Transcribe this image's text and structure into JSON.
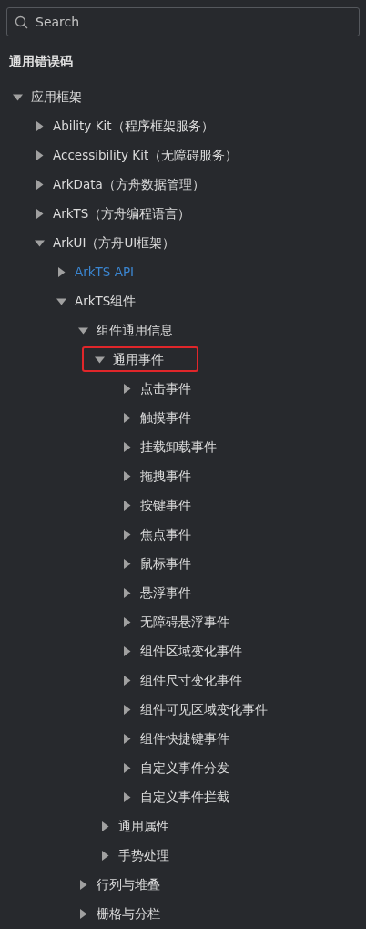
{
  "search": {
    "placeholder": "Search"
  },
  "top_link": "通用错误码",
  "tree": [
    {
      "label": "应用框架",
      "expanded": true,
      "children": [
        {
          "label": "Ability Kit（程序框架服务）",
          "expanded": false
        },
        {
          "label": "Accessibility Kit（无障碍服务）",
          "expanded": false
        },
        {
          "label": "ArkData（方舟数据管理）",
          "expanded": false
        },
        {
          "label": "ArkTS（方舟编程语言）",
          "expanded": false
        },
        {
          "label": "ArkUI（方舟UI框架）",
          "expanded": true,
          "children": [
            {
              "label": "ArkTS API",
              "expanded": false,
              "selected": true
            },
            {
              "label": "ArkTS组件",
              "expanded": true,
              "children": [
                {
                  "label": "组件通用信息",
                  "expanded": true,
                  "children": [
                    {
                      "label": "通用事件",
                      "expanded": true,
                      "highlighted": true,
                      "children": [
                        {
                          "label": "点击事件",
                          "expanded": false
                        },
                        {
                          "label": "触摸事件",
                          "expanded": false
                        },
                        {
                          "label": "挂载卸载事件",
                          "expanded": false
                        },
                        {
                          "label": "拖拽事件",
                          "expanded": false
                        },
                        {
                          "label": "按键事件",
                          "expanded": false
                        },
                        {
                          "label": "焦点事件",
                          "expanded": false
                        },
                        {
                          "label": "鼠标事件",
                          "expanded": false
                        },
                        {
                          "label": "悬浮事件",
                          "expanded": false
                        },
                        {
                          "label": "无障碍悬浮事件",
                          "expanded": false
                        },
                        {
                          "label": "组件区域变化事件",
                          "expanded": false
                        },
                        {
                          "label": "组件尺寸变化事件",
                          "expanded": false
                        },
                        {
                          "label": "组件可见区域变化事件",
                          "expanded": false
                        },
                        {
                          "label": "组件快捷键事件",
                          "expanded": false
                        },
                        {
                          "label": "自定义事件分发",
                          "expanded": false
                        },
                        {
                          "label": "自定义事件拦截",
                          "expanded": false
                        }
                      ]
                    },
                    {
                      "label": "通用属性",
                      "expanded": false
                    },
                    {
                      "label": "手势处理",
                      "expanded": false
                    }
                  ]
                },
                {
                  "label": "行列与堆叠",
                  "expanded": false
                },
                {
                  "label": "栅格与分栏",
                  "expanded": false
                }
              ]
            }
          ]
        }
      ]
    }
  ]
}
